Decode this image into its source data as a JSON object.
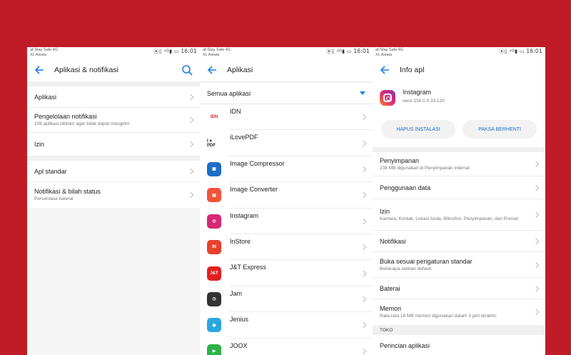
{
  "status": {
    "carrier1": "af-Stay Safe 4G",
    "carrier2": "XL Axiata",
    "icons": "⦿▯ ⁴ᴳ▮ ▭",
    "time": "16:01"
  },
  "screen1": {
    "title": "Aplikasi & notifikasi",
    "items": [
      {
        "label": "Aplikasi",
        "sub": ""
      },
      {
        "label": "Pengelolaan notifikasi",
        "sub": "108 aplikasi diblokir agar tidak dapat mengirim"
      },
      {
        "label": "Izin",
        "sub": ""
      },
      {
        "label": "Apl standar",
        "sub": ""
      },
      {
        "label": "Notifikasi & bilah status",
        "sub": "Persentase baterai"
      }
    ]
  },
  "screen2": {
    "title": "Aplikasi",
    "filter": "Semua aplikasi",
    "apps": [
      {
        "name": "IDN",
        "icon": "IDN",
        "color": "#ffffff",
        "textcolor": "#e02020"
      },
      {
        "name": "iLovePDF",
        "icon": "I ♥ PDF",
        "color": "#ffffff",
        "textcolor": "#222222"
      },
      {
        "name": "Image Compressor",
        "icon": "▣",
        "color": "#1e6ec8",
        "textcolor": "#ffffff"
      },
      {
        "name": "Image Converter",
        "icon": "▤",
        "color": "#f0543c",
        "textcolor": "#ffffff"
      },
      {
        "name": "Instagram",
        "icon": "◎",
        "color": "#d62976",
        "textcolor": "#ffffff"
      },
      {
        "name": "InStore",
        "icon": "IN",
        "color": "#e8412c",
        "textcolor": "#ffffff"
      },
      {
        "name": "J&T Express",
        "icon": "J&T",
        "color": "#e02020",
        "textcolor": "#ffffff"
      },
      {
        "name": "Jam",
        "icon": "◷",
        "color": "#333333",
        "textcolor": "#ffffff"
      },
      {
        "name": "Jenius",
        "icon": "◉",
        "color": "#2aa7e0",
        "textcolor": "#ffffff"
      },
      {
        "name": "JOOX",
        "icon": "▶",
        "color": "#2db24a",
        "textcolor": "#ffffff"
      }
    ]
  },
  "screen3": {
    "title": "Info apl",
    "app_name": "Instagram",
    "version": "versi 150.0.0.33.120",
    "uninstall": "HAPUS INSTALASI",
    "force_stop": "PAKSA BERHENTI",
    "items": [
      {
        "label": "Penyimpanan",
        "sub": "238 MB digunakan di Penyimpanan internal"
      },
      {
        "label": "Penggunaan data",
        "sub": ""
      },
      {
        "label": "Izin",
        "sub": "Kamera, Kontak, Lokasi Anda, Mikrofon, Penyimpanan, dan Ponsel"
      },
      {
        "label": "Notifikasi",
        "sub": ""
      },
      {
        "label": "Buka sesuai pengaturan standar",
        "sub": "Beberapa setelan default"
      },
      {
        "label": "Baterai",
        "sub": ""
      },
      {
        "label": "Memori",
        "sub": "Rata-rata 18 MB memori digunakan dalam 3 jam terakhir"
      }
    ],
    "section": "TOKO",
    "store_item": "Perincian aplikasi"
  },
  "colors": {
    "background": "#c01c28",
    "accent": "#1e7fe8"
  }
}
